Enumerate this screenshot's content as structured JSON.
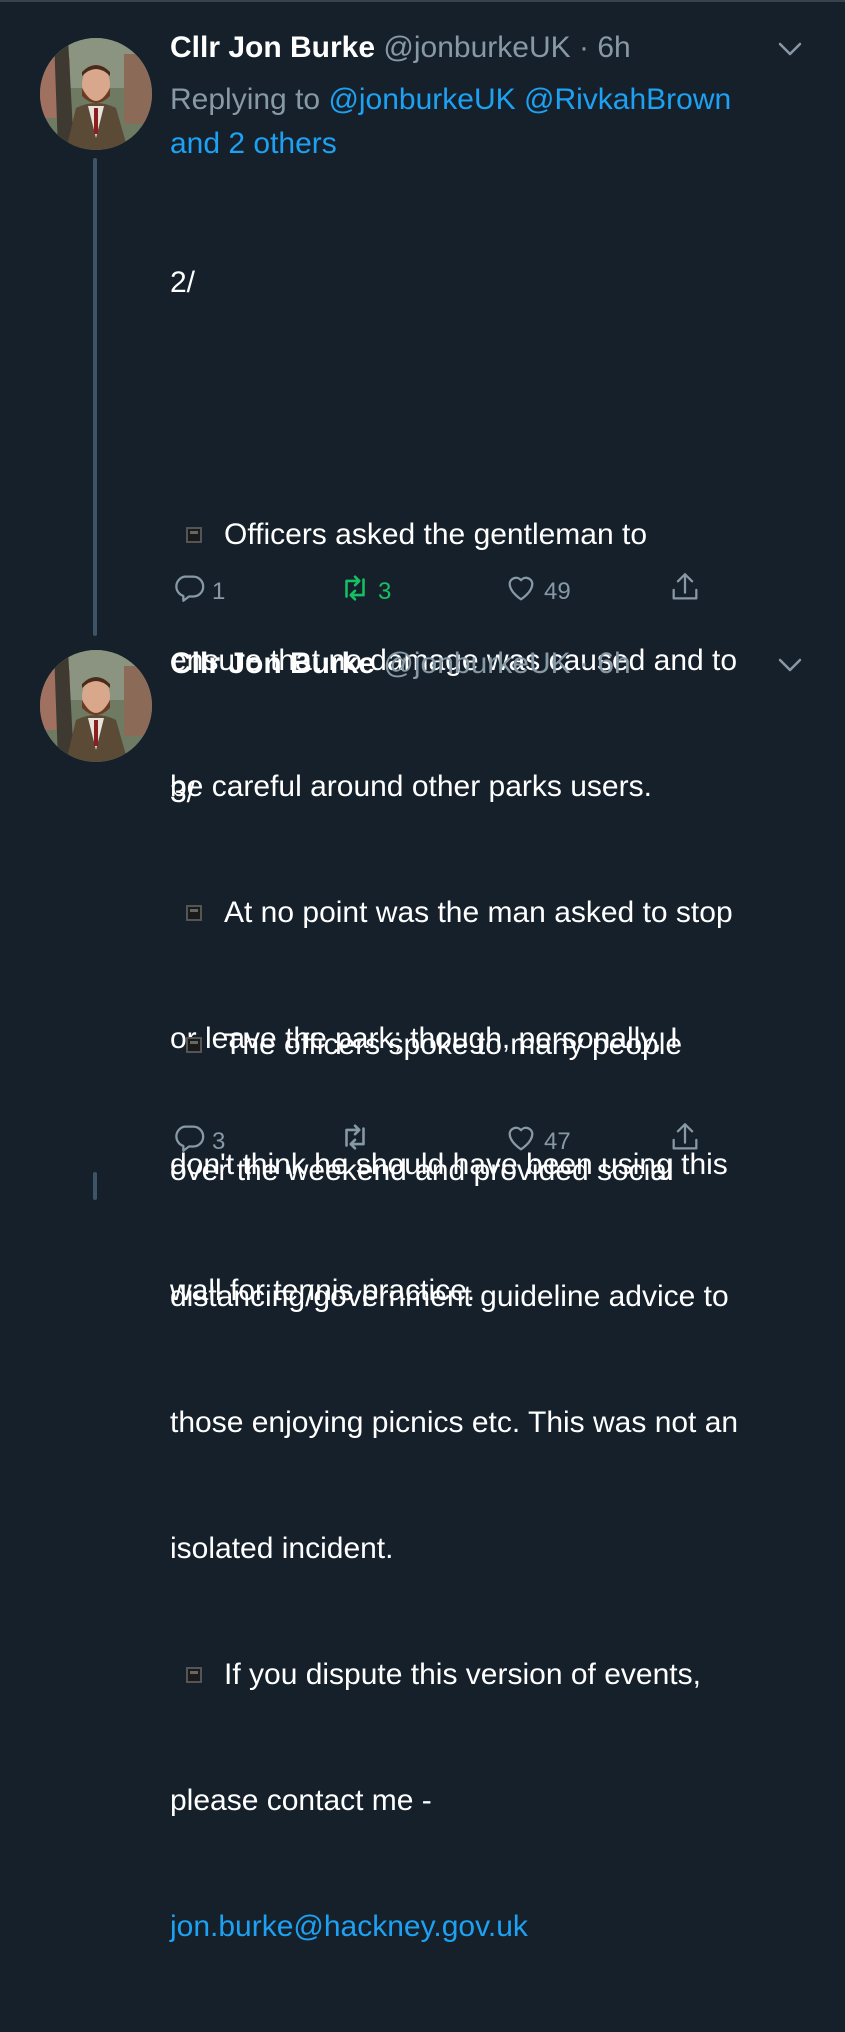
{
  "tweets": [
    {
      "name": "Cllr Jon Burke",
      "handle": "@jonburkeUK",
      "separator": "·",
      "time": "6h",
      "reply_prefix": "Replying to ",
      "reply_user1": "@jonburkeUK",
      "reply_user2": "@RivkahBrown",
      "reply_others": "and 2 others",
      "lines": {
        "l0": "2/",
        "l1": "Officers asked the gentleman to",
        "l2": "ensure that no damage was caused and to",
        "l3": "be careful around other parks users.",
        "l4": "At no point was the man asked to stop",
        "l5": "or leave the park; though, personally, I",
        "l6": "don't think he should have been using this",
        "l7": "wall for tennis practice."
      },
      "replies": "1",
      "retweets": "3",
      "likes": "49"
    },
    {
      "name": "Cllr Jon Burke",
      "handle": "@jonburkeUK",
      "separator": "·",
      "time": "6h",
      "lines": {
        "l0": "3/",
        "l1": "The officers spoke to many people",
        "l2": "over the weekend and provided social",
        "l3": "distancing/government guideline advice to",
        "l4": "those enjoying picnics etc. This was not an",
        "l5": "isolated incident.",
        "l6": "If you dispute this version of events,",
        "l7": "please contact me -",
        "l8": "jon.burke@hackney.gov.uk"
      },
      "replies": "3",
      "retweets": "",
      "likes": "47"
    }
  ],
  "icons": {
    "reply": "reply-icon",
    "retweet": "retweet-icon",
    "like": "heart-icon",
    "share": "share-icon",
    "menu": "chevron-down-icon"
  },
  "colors": {
    "background": "#15202b",
    "link": "#1da1f2",
    "muted": "#8899a6",
    "retweet_active": "#17bf63"
  }
}
